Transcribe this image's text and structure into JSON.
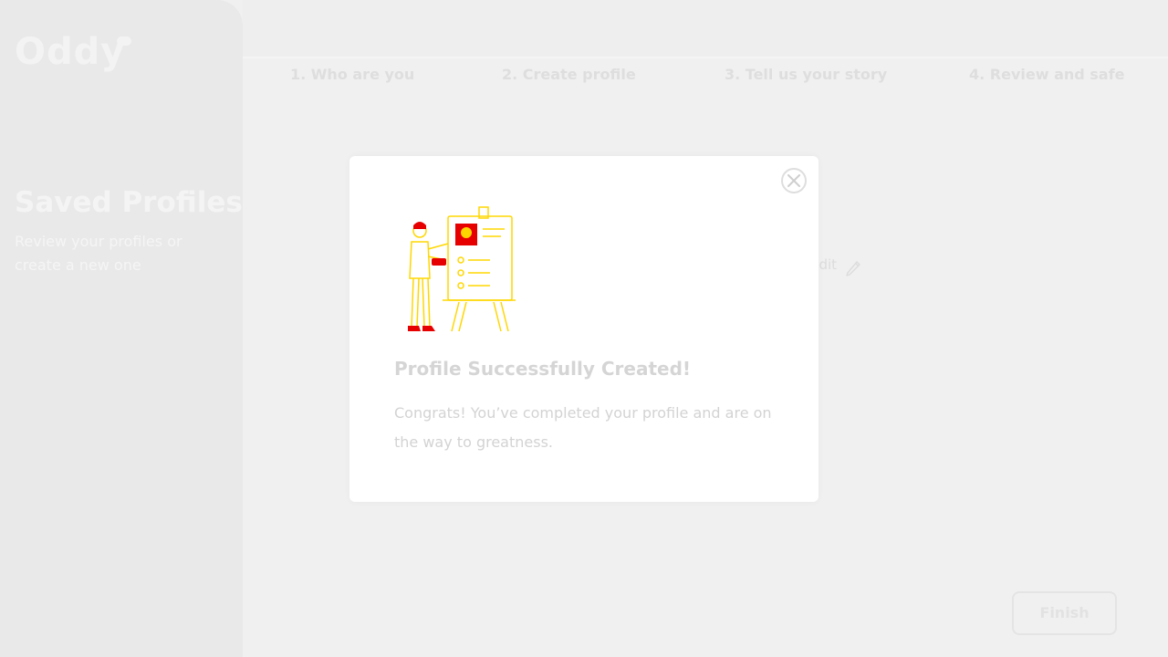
{
  "app": {
    "logo_text": "Oddy"
  },
  "sidebar": {
    "title": "Saved Profiles",
    "subtitle": "Review your profiles or create a new one"
  },
  "steps": [
    {
      "label": "1. Who are you"
    },
    {
      "label": "2. Create profile"
    },
    {
      "label": "3. Tell us your story"
    },
    {
      "label": "4. Review and safe"
    }
  ],
  "content": {
    "edit_label": "Edit"
  },
  "footer": {
    "finish_label": "Finish"
  },
  "modal": {
    "title": "Profile Successfully Created!",
    "body": "Congrats! You’ve completed your profile and are on the way to greatness.",
    "illustration_icon": "presentation-easel-icon",
    "close_icon": "close-icon"
  },
  "colors": {
    "overlay_bg": "#f0f0f0",
    "modal_bg": "#ffffff",
    "illustration_red": "#e60000",
    "illustration_yellow": "#ffd700"
  }
}
